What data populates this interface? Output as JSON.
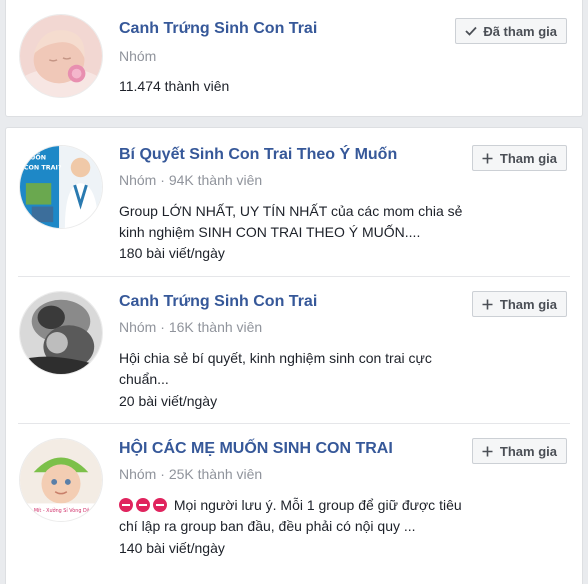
{
  "joined_group": {
    "name": "Canh Trứng Sinh Con Trai",
    "type": "Nhóm",
    "members": "11.474 thành viên",
    "button": "Đã tham gia",
    "button_icon": "check-icon"
  },
  "suggested_groups": [
    {
      "name": "Bí Quyết Sinh Con Trai Theo Ý Muốn",
      "type": "Nhóm",
      "separator": "·",
      "members": "94K thành viên",
      "description": "Group LỚN NHẤT, UY TÍN NHẤT của các mom chia sẻ kinh nghiệm SINH CON TRAI THEO Ý MUỐN....",
      "posts": "180 bài viết/ngày",
      "button": "Tham gia",
      "avatar_text": "MUỐN\nCON TRAI?"
    },
    {
      "name": "Canh Trứng Sinh Con Trai",
      "type": "Nhóm",
      "separator": "·",
      "members": "16K thành viên",
      "description": "Hội chia sẻ bí quyết, kinh nghiệm sinh con trai cực chuẩn...",
      "posts": "20 bài viết/ngày",
      "button": "Tham gia"
    },
    {
      "name": "HỘI CÁC MẸ MUỐN SINH CON TRAI",
      "type": "Nhóm",
      "separator": "·",
      "members": "25K thành viên",
      "description": "Mọi người lưu ý. Mỗi 1 group để giữ được tiêu chí lập ra group ban đầu, đều phải có nội quy ...",
      "description_prefix_icons": [
        "no-entry-icon",
        "no-entry-icon",
        "no-entry-icon"
      ],
      "posts": "140 bài viết/ngày",
      "button": "Tham gia",
      "avatar_text": "n Mít - Xưởng Sỉ Vòng Dâu"
    }
  ],
  "colors": {
    "link": "#365899",
    "meta": "#90949c",
    "text": "#1d2129",
    "background": "#e9ebee"
  }
}
